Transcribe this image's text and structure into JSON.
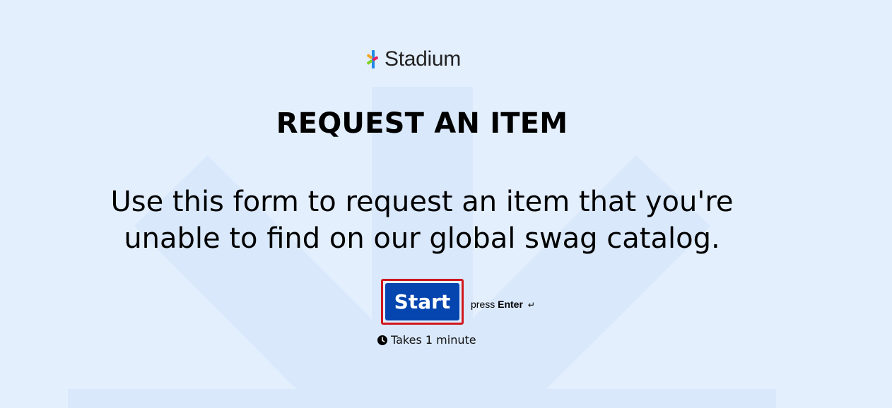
{
  "brand": {
    "name": "Stadium",
    "logo_colors": [
      "#f5a623",
      "#7ed321",
      "#1e88e5",
      "#e91e63"
    ]
  },
  "page": {
    "title": "REQUEST AN ITEM",
    "description_line1": "Use this form to request an item that you're",
    "description_line2": "unable to find on our global swag catalog."
  },
  "start": {
    "label": "Start",
    "hint_prefix": "press",
    "hint_key": "Enter",
    "hint_icon": "↵"
  },
  "duration": {
    "text": "Takes 1 minute",
    "icon": "clock-icon"
  },
  "colors": {
    "background": "#e3effd",
    "arrow_shape": "#d9e8fb",
    "button": "#0445af",
    "focus_outline": "#d0171f"
  }
}
